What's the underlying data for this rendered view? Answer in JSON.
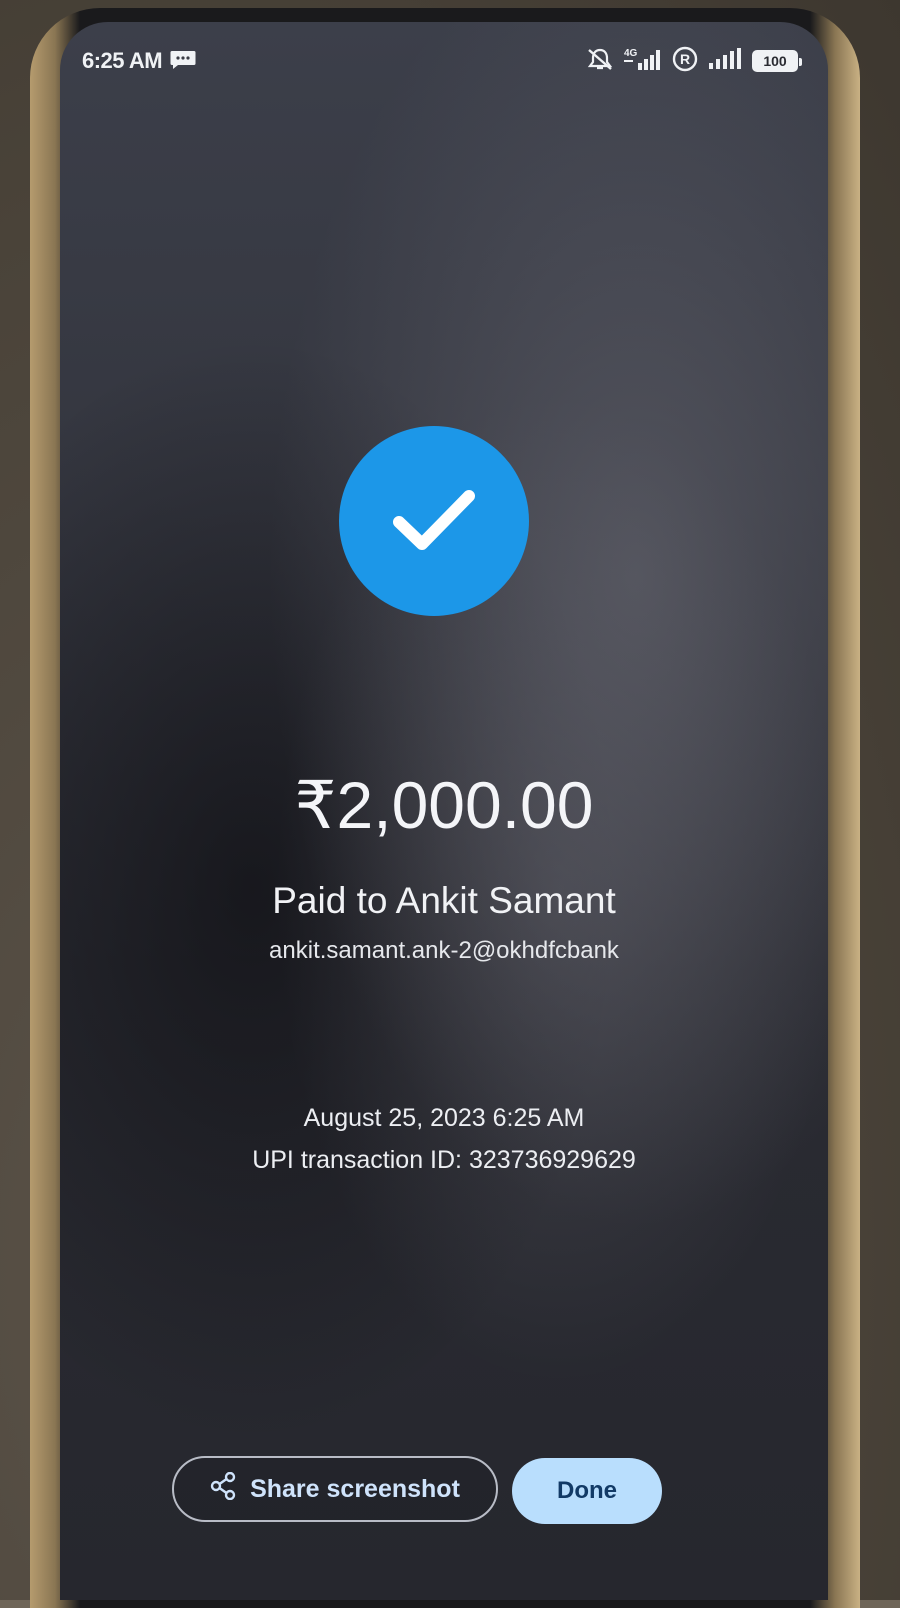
{
  "status_bar": {
    "time": "6:25 AM",
    "battery_level": "100",
    "icons": [
      "message-icon",
      "mute-icon",
      "signal-4g-icon",
      "roaming-icon",
      "signal-icon",
      "battery-icon"
    ]
  },
  "payment": {
    "amount": "₹2,000.00",
    "paid_to": "Paid to Ankit Samant",
    "upi_id": "ankit.samant.ank-2@okhdfcbank",
    "datetime": "August 25, 2023 6:25 AM",
    "transaction_id": "UPI transaction ID: 323736929629"
  },
  "actions": {
    "share_label": "Share screenshot",
    "done_label": "Done"
  },
  "colors": {
    "success_circle": "#1c97e8",
    "done_button": "#b9defd",
    "done_text": "#123a66",
    "share_text": "#cfe3fb"
  }
}
